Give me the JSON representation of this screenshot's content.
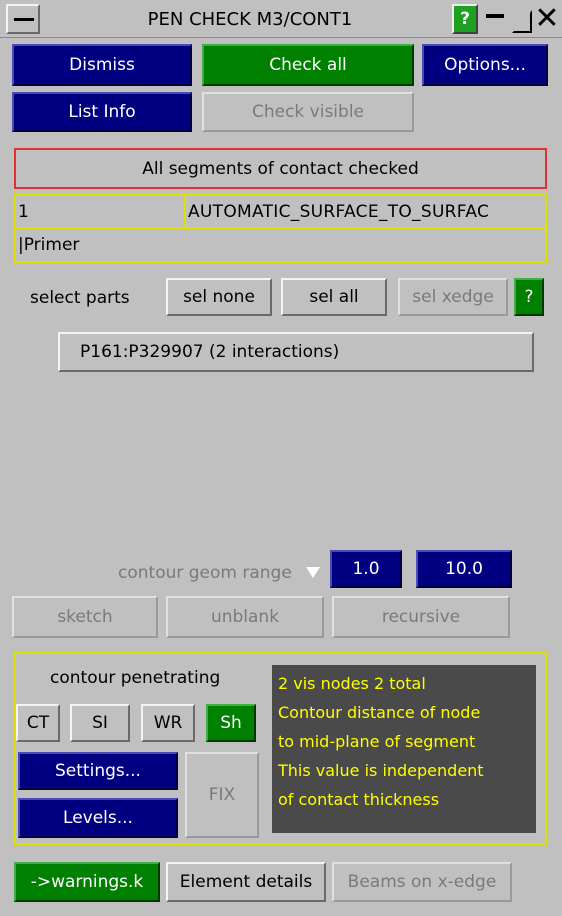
{
  "window": {
    "title": "PEN CHECK M3/CONT1"
  },
  "titlebar_icons": [
    "menu-icon",
    "help-icon",
    "minimize-icon",
    "maximize-icon",
    "close-icon"
  ],
  "titlebar": {
    "help_label": "?"
  },
  "toolbar": {
    "dismiss": "Dismiss",
    "check_all": "Check all",
    "options": "Options...",
    "list_info": "List Info",
    "check_visible": "Check visible"
  },
  "status": {
    "message": "All segments of contact checked"
  },
  "contact": {
    "id": "1",
    "type": "AUTOMATIC_SURFACE_TO_SURFAC",
    "name": "|Primer"
  },
  "parts": {
    "label": "select parts",
    "sel_none": "sel none",
    "sel_all": "sel all",
    "sel_xedge": "sel xedge",
    "help": "?",
    "items": [
      "P161:P329907 (2 interactions)"
    ]
  },
  "contour_range": {
    "label": "contour geom range",
    "min": "1.0",
    "max": "10.0"
  },
  "view_actions": {
    "sketch": "sketch",
    "unblank": "unblank",
    "recursive": "recursive"
  },
  "contour": {
    "label": "contour penetrating",
    "modes": [
      "CT",
      "SI",
      "WR",
      "Sh"
    ],
    "active_mode": "Sh",
    "settings": "Settings...",
    "levels": "Levels...",
    "fix": "FIX"
  },
  "info_box": {
    "lines": [
      "2 vis nodes 2 total",
      "Contour distance of node",
      "to mid-plane of segment",
      "This value is independent",
      "of contact thickness"
    ]
  },
  "footer": {
    "warnings": "->warnings.k",
    "element_details": "Element details",
    "beams_on_xedge": "Beams on x-edge"
  },
  "colors": {
    "panel_bg": "#c0c0c0",
    "button_blue": "#000080",
    "button_green": "#008000",
    "highlight_yellow": "#e0e000",
    "status_border_red": "#e03030",
    "tooltip_bg": "#4a4a4a",
    "tooltip_text": "#ffff00"
  }
}
